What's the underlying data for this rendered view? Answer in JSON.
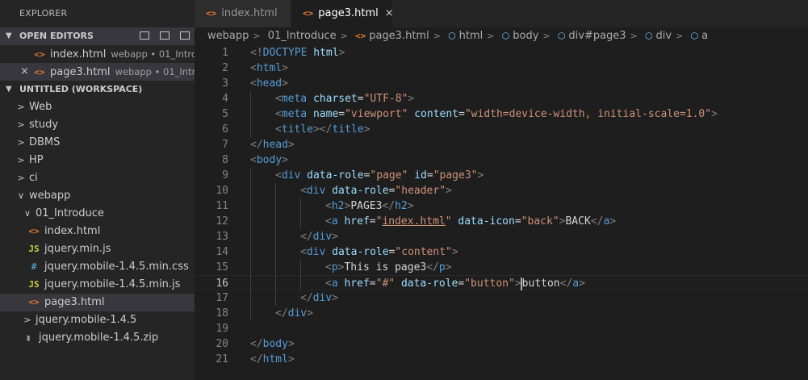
{
  "explorer": {
    "title": "EXPLORER",
    "open_editors": {
      "label": "OPEN EDITORS",
      "items": [
        {
          "name": "index.html",
          "desc": "webapp • 01_Introd..."
        },
        {
          "name": "page3.html",
          "desc": "webapp • 01_Intro..."
        }
      ]
    },
    "workspace": {
      "label": "UNTITLED (WORKSPACE)",
      "folders": [
        "Web",
        "study",
        "DBMS",
        "HP",
        "ci",
        "webapp"
      ],
      "subfolder": "01_Introduce",
      "files": [
        {
          "name": "index.html",
          "type": "html"
        },
        {
          "name": "jquery.min.js",
          "type": "js"
        },
        {
          "name": "jquery.mobile-1.4.5.min.css",
          "type": "css"
        },
        {
          "name": "jquery.mobile-1.4.5.min.js",
          "type": "js"
        },
        {
          "name": "page3.html",
          "type": "html"
        }
      ],
      "folder2": "jquery.mobile-1.4.5",
      "zip": "jquery.mobile-1.4.5.zip"
    }
  },
  "tabs": [
    {
      "label": "index.html",
      "active": false
    },
    {
      "label": "page3.html",
      "active": true
    }
  ],
  "icons": {
    "html": "<>",
    "js": "JS",
    "css": "#",
    "close": "×"
  },
  "breadcrumb": [
    "webapp",
    "01_Introduce",
    "page3.html",
    "html",
    "body",
    "div#page3",
    "div",
    "a"
  ],
  "code": {
    "current_line": 16,
    "lines": [
      {
        "n": "1",
        "indent": 0,
        "tokens": [
          [
            "p",
            "<!"
          ],
          [
            "t",
            "DOCTYPE"
          ],
          [
            "x",
            " "
          ],
          [
            "a",
            "html"
          ],
          [
            "p",
            ">"
          ]
        ]
      },
      {
        "n": "2",
        "indent": 0,
        "tokens": [
          [
            "p",
            "<"
          ],
          [
            "t",
            "html"
          ],
          [
            "p",
            ">"
          ]
        ]
      },
      {
        "n": "3",
        "indent": 0,
        "tokens": [
          [
            "p",
            "<"
          ],
          [
            "t",
            "head"
          ],
          [
            "p",
            ">"
          ]
        ]
      },
      {
        "n": "4",
        "indent": 1,
        "tokens": [
          [
            "p",
            "<"
          ],
          [
            "t",
            "meta"
          ],
          [
            "x",
            " "
          ],
          [
            "a",
            "charset"
          ],
          [
            "x",
            "="
          ],
          [
            "s",
            "\"UTF-8\""
          ],
          [
            "p",
            ">"
          ]
        ]
      },
      {
        "n": "5",
        "indent": 1,
        "tokens": [
          [
            "p",
            "<"
          ],
          [
            "t",
            "meta"
          ],
          [
            "x",
            " "
          ],
          [
            "a",
            "name"
          ],
          [
            "x",
            "="
          ],
          [
            "s",
            "\"viewport\""
          ],
          [
            "x",
            " "
          ],
          [
            "a",
            "content"
          ],
          [
            "x",
            "="
          ],
          [
            "s",
            "\"width=device-width, initial-scale=1.0\""
          ],
          [
            "p",
            ">"
          ]
        ]
      },
      {
        "n": "6",
        "indent": 1,
        "tokens": [
          [
            "p",
            "<"
          ],
          [
            "t",
            "title"
          ],
          [
            "p",
            "></"
          ],
          [
            "t",
            "title"
          ],
          [
            "p",
            ">"
          ]
        ]
      },
      {
        "n": "7",
        "indent": 0,
        "tokens": [
          [
            "p",
            "</"
          ],
          [
            "t",
            "head"
          ],
          [
            "p",
            ">"
          ]
        ]
      },
      {
        "n": "8",
        "indent": 0,
        "tokens": [
          [
            "p",
            "<"
          ],
          [
            "t",
            "body"
          ],
          [
            "p",
            ">"
          ]
        ]
      },
      {
        "n": "9",
        "indent": 1,
        "tokens": [
          [
            "p",
            "<"
          ],
          [
            "t",
            "div"
          ],
          [
            "x",
            " "
          ],
          [
            "a",
            "data-role"
          ],
          [
            "x",
            "="
          ],
          [
            "s",
            "\"page\""
          ],
          [
            "x",
            " "
          ],
          [
            "a",
            "id"
          ],
          [
            "x",
            "="
          ],
          [
            "s",
            "\"page3\""
          ],
          [
            "p",
            ">"
          ]
        ]
      },
      {
        "n": "10",
        "indent": 2,
        "tokens": [
          [
            "p",
            "<"
          ],
          [
            "t",
            "div"
          ],
          [
            "x",
            " "
          ],
          [
            "a",
            "data-role"
          ],
          [
            "x",
            "="
          ],
          [
            "s",
            "\"header\""
          ],
          [
            "p",
            ">"
          ]
        ]
      },
      {
        "n": "11",
        "indent": 3,
        "tokens": [
          [
            "p",
            "<"
          ],
          [
            "t",
            "h2"
          ],
          [
            "p",
            ">"
          ],
          [
            "x",
            "PAGE3"
          ],
          [
            "p",
            "</"
          ],
          [
            "t",
            "h2"
          ],
          [
            "p",
            ">"
          ]
        ]
      },
      {
        "n": "12",
        "indent": 3,
        "tokens": [
          [
            "p",
            "<"
          ],
          [
            "t",
            "a"
          ],
          [
            "x",
            " "
          ],
          [
            "a",
            "href"
          ],
          [
            "x",
            "="
          ],
          [
            "s",
            "\""
          ],
          [
            "u",
            "index.html"
          ],
          [
            "s",
            "\""
          ],
          [
            "x",
            " "
          ],
          [
            "a",
            "data-icon"
          ],
          [
            "x",
            "="
          ],
          [
            "s",
            "\"back\""
          ],
          [
            "p",
            ">"
          ],
          [
            "x",
            "BACK"
          ],
          [
            "p",
            "</"
          ],
          [
            "t",
            "a"
          ],
          [
            "p",
            ">"
          ]
        ]
      },
      {
        "n": "13",
        "indent": 2,
        "tokens": [
          [
            "p",
            "</"
          ],
          [
            "t",
            "div"
          ],
          [
            "p",
            ">"
          ]
        ]
      },
      {
        "n": "14",
        "indent": 2,
        "tokens": [
          [
            "p",
            "<"
          ],
          [
            "t",
            "div"
          ],
          [
            "x",
            " "
          ],
          [
            "a",
            "data-role"
          ],
          [
            "x",
            "="
          ],
          [
            "s",
            "\"content\""
          ],
          [
            "p",
            ">"
          ]
        ]
      },
      {
        "n": "15",
        "indent": 3,
        "tokens": [
          [
            "p",
            "<"
          ],
          [
            "t",
            "p"
          ],
          [
            "p",
            ">"
          ],
          [
            "x",
            "This is page3"
          ],
          [
            "p",
            "</"
          ],
          [
            "t",
            "p"
          ],
          [
            "p",
            ">"
          ]
        ]
      },
      {
        "n": "16",
        "indent": 3,
        "tokens": [
          [
            "p",
            "<"
          ],
          [
            "t",
            "a"
          ],
          [
            "x",
            " "
          ],
          [
            "a",
            "href"
          ],
          [
            "x",
            "="
          ],
          [
            "s",
            "\"#\""
          ],
          [
            "x",
            " "
          ],
          [
            "a",
            "data-role"
          ],
          [
            "x",
            "="
          ],
          [
            "s",
            "\"button\""
          ],
          [
            "p",
            ">"
          ],
          [
            "c",
            ""
          ],
          [
            "x",
            "button"
          ],
          [
            "p",
            "</"
          ],
          [
            "t",
            "a"
          ],
          [
            "p",
            ">"
          ]
        ]
      },
      {
        "n": "17",
        "indent": 2,
        "tokens": [
          [
            "p",
            "</"
          ],
          [
            "t",
            "div"
          ],
          [
            "p",
            ">"
          ]
        ]
      },
      {
        "n": "18",
        "indent": 1,
        "tokens": [
          [
            "p",
            "</"
          ],
          [
            "t",
            "div"
          ],
          [
            "p",
            ">"
          ]
        ]
      },
      {
        "n": "19",
        "indent": 0,
        "tokens": []
      },
      {
        "n": "20",
        "indent": 0,
        "tokens": [
          [
            "p",
            "</"
          ],
          [
            "t",
            "body"
          ],
          [
            "p",
            ">"
          ]
        ]
      },
      {
        "n": "21",
        "indent": 0,
        "tokens": [
          [
            "p",
            "</"
          ],
          [
            "t",
            "html"
          ],
          [
            "p",
            ">"
          ]
        ]
      }
    ]
  }
}
